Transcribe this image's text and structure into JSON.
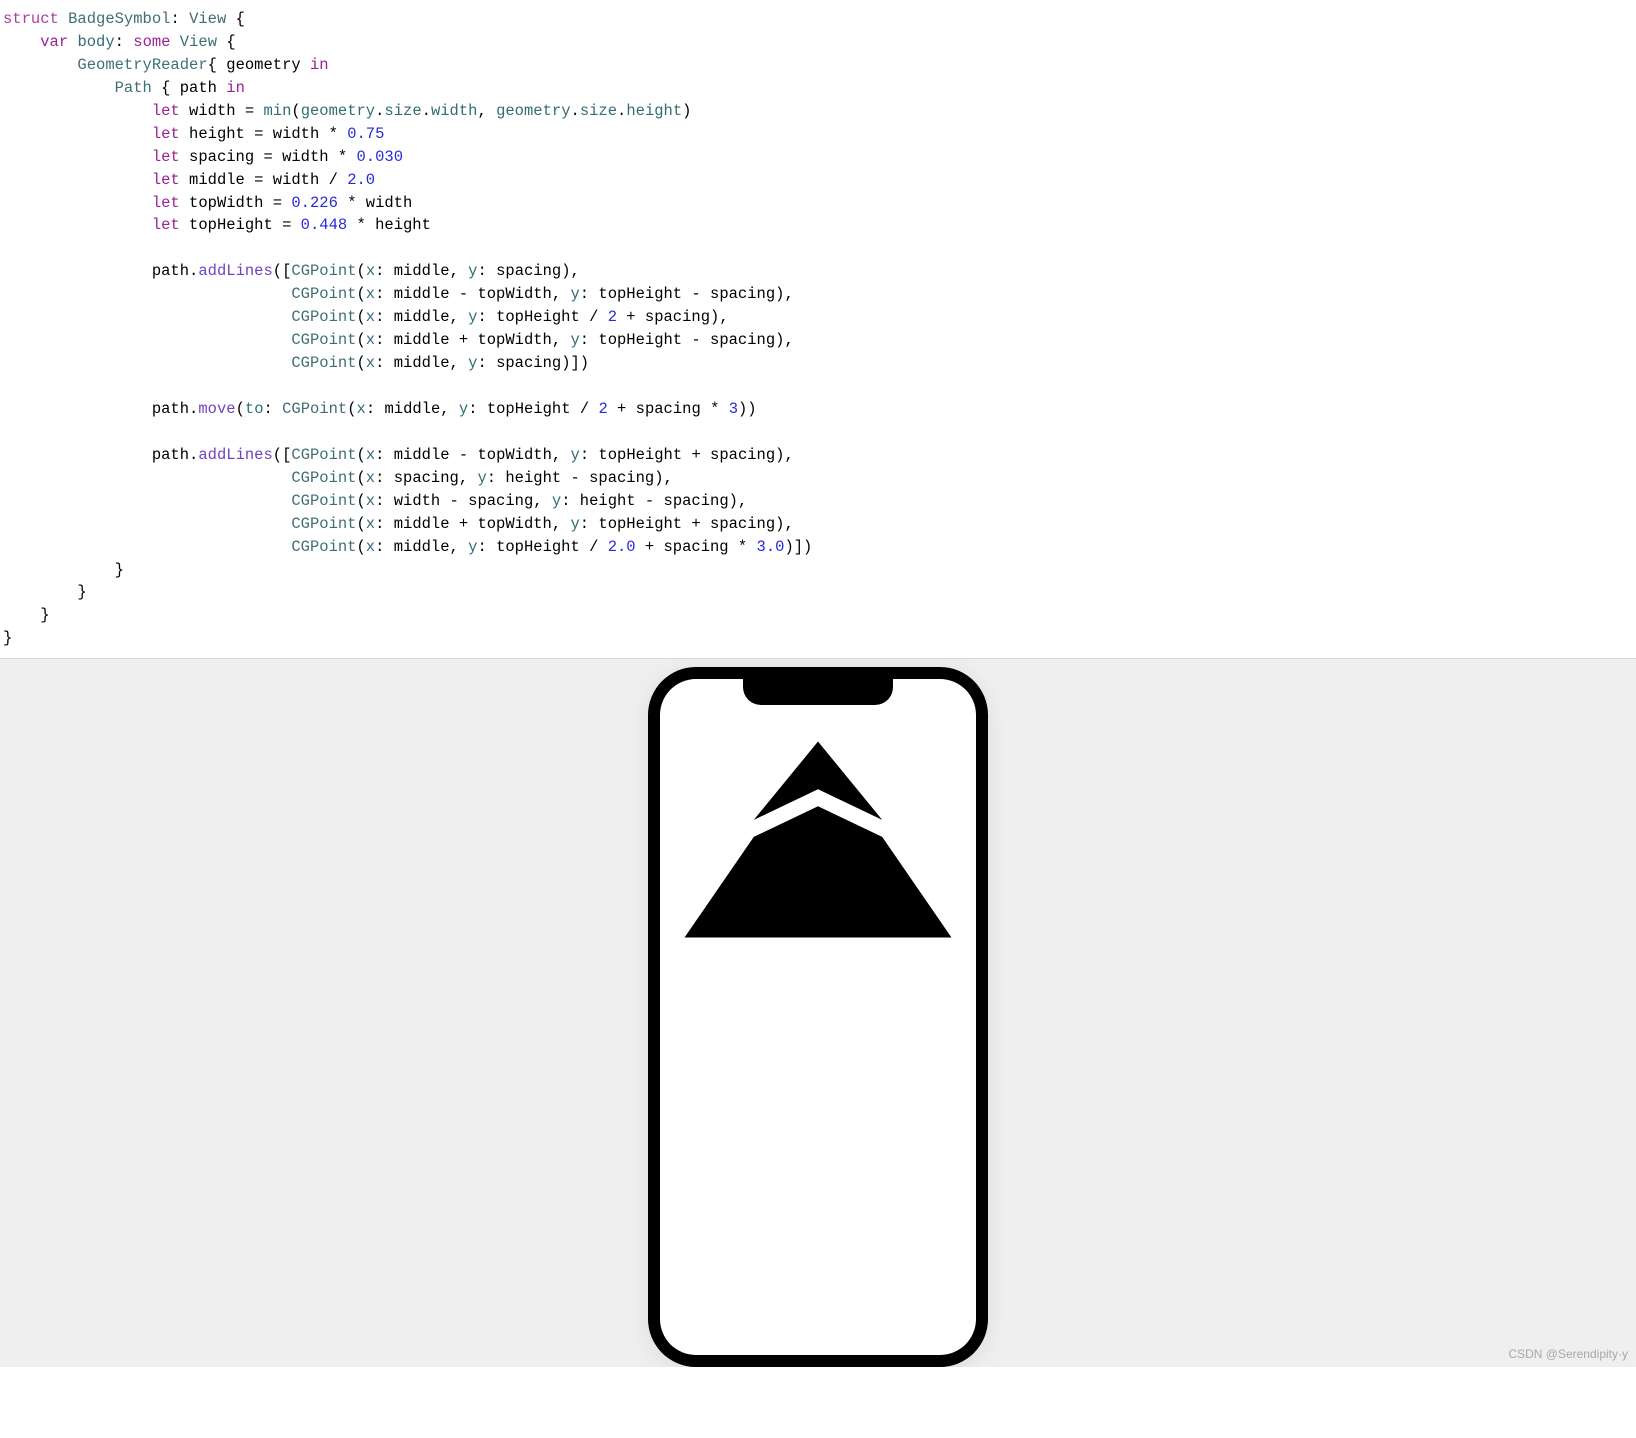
{
  "code": {
    "t": {
      "struct": "struct",
      "var": "var",
      "some": "some",
      "let": "let",
      "in": "in",
      "BadgeSymbol": "BadgeSymbol",
      "View": "View",
      "body": "body",
      "GeometryReader": "GeometryReader",
      "geometry": "geometry",
      "Path": "Path",
      "path": "path",
      "width": "width",
      "height": "height",
      "spacing": "spacing",
      "middle": "middle",
      "topWidth": "topWidth",
      "topHeight": "topHeight",
      "min": "min",
      "size": "size",
      "addLines": "addLines",
      "move": "move",
      "to": "to",
      "CGPoint": "CGPoint",
      "x": "x",
      "y": "y",
      "n075": "0.75",
      "n0030": "0.030",
      "n20": "2.0",
      "n0226": "0.226",
      "n0448": "0.448",
      "n2": "2",
      "n3": "3",
      "n30": "3.0"
    }
  },
  "watermark": "CSDN @Serendipity·y"
}
